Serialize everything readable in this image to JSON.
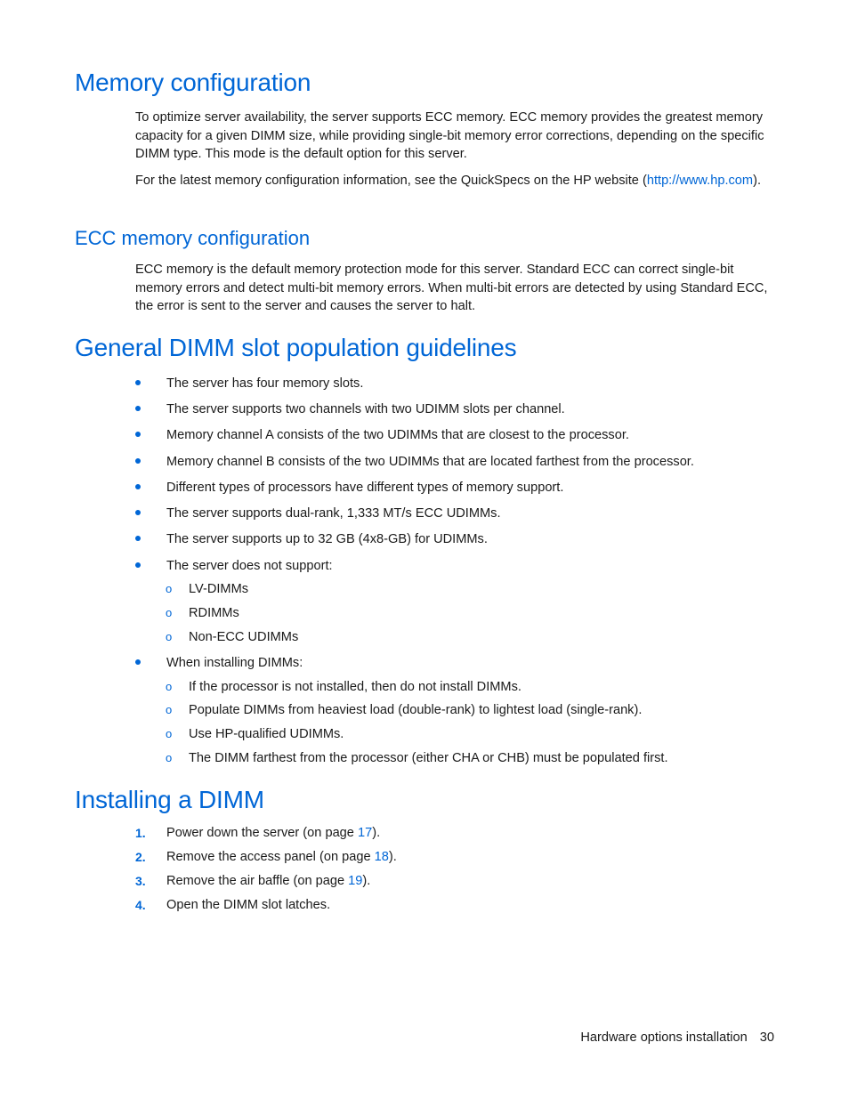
{
  "sections": {
    "memory_config": {
      "title": "Memory configuration",
      "para1": "To optimize server availability, the server supports ECC memory. ECC memory provides the greatest memory capacity for a given DIMM size, while providing single-bit memory error corrections, depending on the specific DIMM type. This mode is the default option for this server.",
      "para2_prefix": "For the latest memory configuration information, see the QuickSpecs on the HP website (",
      "para2_link": "http://www.hp.com",
      "para2_suffix": ")."
    },
    "ecc_config": {
      "title": "ECC memory configuration",
      "para": "ECC memory is the default memory protection mode for this server. Standard ECC can correct single-bit memory errors and detect multi-bit memory errors. When multi-bit errors are detected by using Standard ECC, the error is sent to the server and causes the server to halt."
    },
    "guidelines": {
      "title": "General DIMM slot population guidelines",
      "bullets": [
        "The server has four memory slots.",
        "The server supports two channels with two UDIMM slots per channel.",
        "Memory channel A consists of the two UDIMMs that are closest to the processor.",
        "Memory channel B consists of the two UDIMMs that are located farthest from the processor.",
        "Different types of processors have different types of memory support.",
        "The server supports dual-rank, 1,333 MT/s ECC UDIMMs.",
        "The server supports up to 32 GB (4x8-GB) for UDIMMs.",
        "The server does not support:",
        "When installing DIMMs:"
      ],
      "not_supported": [
        "LV-DIMMs",
        "RDIMMs",
        "Non-ECC UDIMMs"
      ],
      "installing": [
        "If the processor is not installed, then do not install DIMMs.",
        "Populate DIMMs from heaviest load (double-rank) to lightest load (single-rank).",
        "Use HP-qualified UDIMMs.",
        "The DIMM farthest from the processor (either CHA or CHB) must be populated first."
      ],
      "sub_marker": "o"
    },
    "installing": {
      "title": "Installing a DIMM",
      "steps": [
        {
          "num": "1.",
          "text": "Power down the server (on page ",
          "link": "17",
          "suffix": ")."
        },
        {
          "num": "2.",
          "text": "Remove the access panel (on page ",
          "link": "18",
          "suffix": ")."
        },
        {
          "num": "3.",
          "text": "Remove the air baffle (on page ",
          "link": "19",
          "suffix": ")."
        },
        {
          "num": "4.",
          "text": "Open the DIMM slot latches.",
          "link": "",
          "suffix": ""
        }
      ]
    }
  },
  "footer": {
    "section": "Hardware options installation",
    "page": "30"
  },
  "colors": {
    "accent": "#0066d6",
    "text": "#1a1a1a"
  }
}
